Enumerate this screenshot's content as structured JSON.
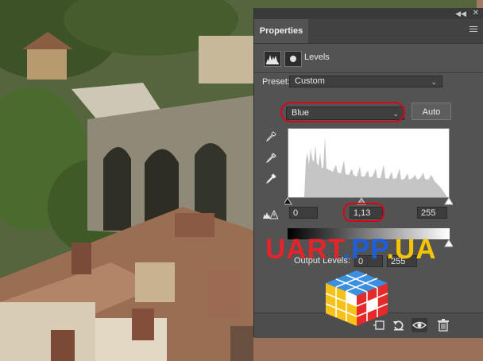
{
  "panel": {
    "tab_label": "Properties",
    "collapse_label": "◀◀",
    "close_label": "✕",
    "adjustment_title": "Levels"
  },
  "preset": {
    "label": "Preset:",
    "value": "Custom"
  },
  "channel": {
    "value": "Blue",
    "auto_label": "Auto"
  },
  "input_levels": {
    "black": "0",
    "gamma": "1,13",
    "white": "255"
  },
  "output_levels": {
    "label": "Output Levels:",
    "black": "0",
    "white": "255"
  },
  "watermark": {
    "part1": "UART",
    "dot1": ".",
    "part2": "PP",
    "dot2": ".",
    "part3": "UA"
  },
  "icons": {
    "eyedroppers": [
      "black-point-eyedropper-icon",
      "gray-point-eyedropper-icon",
      "white-point-eyedropper-icon"
    ],
    "bottom": [
      "clip-to-layer-icon",
      "reset-icon",
      "visibility-eye-icon",
      "delete-icon"
    ]
  },
  "colors": {
    "panel_bg": "#535353",
    "highlight_ring": "#d8061a",
    "watermark_red": "#e3242b",
    "watermark_blue": "#1e5fd8",
    "watermark_yellow": "#f5c400"
  }
}
